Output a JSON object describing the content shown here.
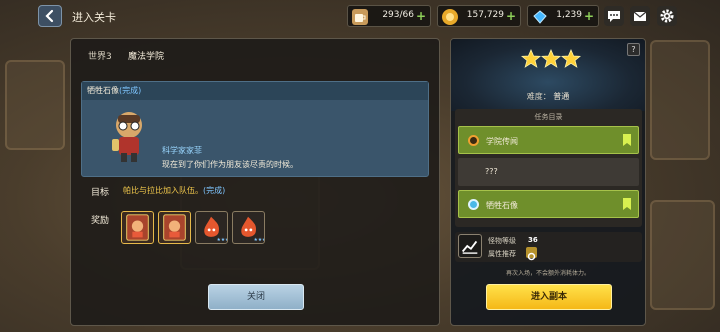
{
  "topbar": {
    "title": "进入关卡",
    "resources": [
      {
        "icon": "coffee-cup-icon",
        "value": "293/66"
      },
      {
        "icon": "gold-coin-icon",
        "value": "157,729"
      },
      {
        "icon": "blue-gem-icon",
        "value": "1,239"
      }
    ],
    "icons": [
      "chat-icon",
      "mail-icon",
      "settings-icon"
    ]
  },
  "stage": {
    "world": "世界3",
    "name": "魔法学院"
  },
  "quest_card": {
    "title": "牺牲石像",
    "status": "(完成)",
    "speaker": "科学家家菲",
    "speech": "现在到了你们作为朋友该尽责的时候。"
  },
  "goal": {
    "label": "目标",
    "text": "帕比与拉比加入队伍。",
    "status": "(完成)"
  },
  "rewards": {
    "label": "奖励",
    "items": [
      "hero-card-icon",
      "hero-card-icon",
      "fire-monster-icon",
      "fire-monster-icon"
    ]
  },
  "buttons": {
    "close": "关闭",
    "enter": "进入副本"
  },
  "right_panel": {
    "stars": 3,
    "difficulty_label": "难度：",
    "difficulty_value": "普通",
    "list_caption": "任务目录",
    "quests": [
      {
        "label": "学院传闻",
        "state": "active",
        "marker": "orange"
      },
      {
        "label": "???",
        "state": "plain",
        "marker": "none"
      },
      {
        "label": "牺牲石像",
        "state": "active",
        "marker": "blue"
      }
    ],
    "monster_level_label": "怪物等级",
    "monster_level": "36",
    "attribute_label": "属性推荐",
    "hint": "再次入场，不会额外消耗体力。"
  },
  "colors": {
    "accent_yellow": "#f5b817",
    "active_row": "#6f8f2b",
    "complete_text": "#7fc6ff",
    "goal_text": "#f2c94c"
  }
}
